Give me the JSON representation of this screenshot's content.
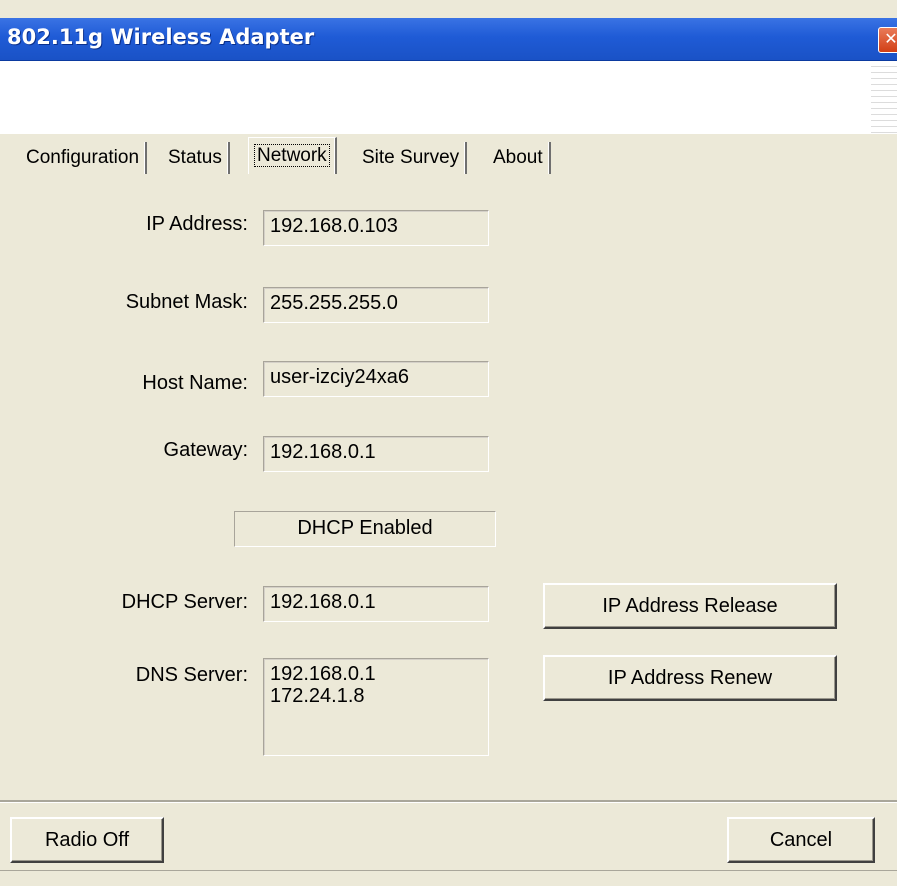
{
  "window": {
    "title": "802.11g Wireless Adapter",
    "close_glyph": "✕"
  },
  "tabs": [
    {
      "label": "Configuration",
      "active": false
    },
    {
      "label": "Status",
      "active": false
    },
    {
      "label": "Network",
      "active": true
    },
    {
      "label": "Site Survey",
      "active": false
    },
    {
      "label": "About",
      "active": false
    }
  ],
  "network": {
    "ip_address_label": "IP Address:",
    "ip_address_value": "192.168.0.103",
    "subnet_mask_label": "Subnet Mask:",
    "subnet_mask_value": "255.255.255.0",
    "host_name_label": "Host Name:",
    "host_name_value": "user-izciy24xa6",
    "gateway_label": "Gateway:",
    "gateway_value": "192.168.0.1",
    "dhcp_status": "DHCP Enabled",
    "dhcp_server_label": "DHCP Server:",
    "dhcp_server_value": "192.168.0.1",
    "dns_server_label": "DNS Server:",
    "dns_server_value": "192.168.0.1\n172.24.1.8"
  },
  "buttons": {
    "ip_release": "IP Address Release",
    "ip_renew": "IP Address Renew",
    "radio_off": "Radio Off",
    "cancel": "Cancel"
  },
  "colors": {
    "title_bar": "#1f5bd6",
    "face": "#ece9d8"
  },
  "icons": {
    "close": "close-icon"
  }
}
